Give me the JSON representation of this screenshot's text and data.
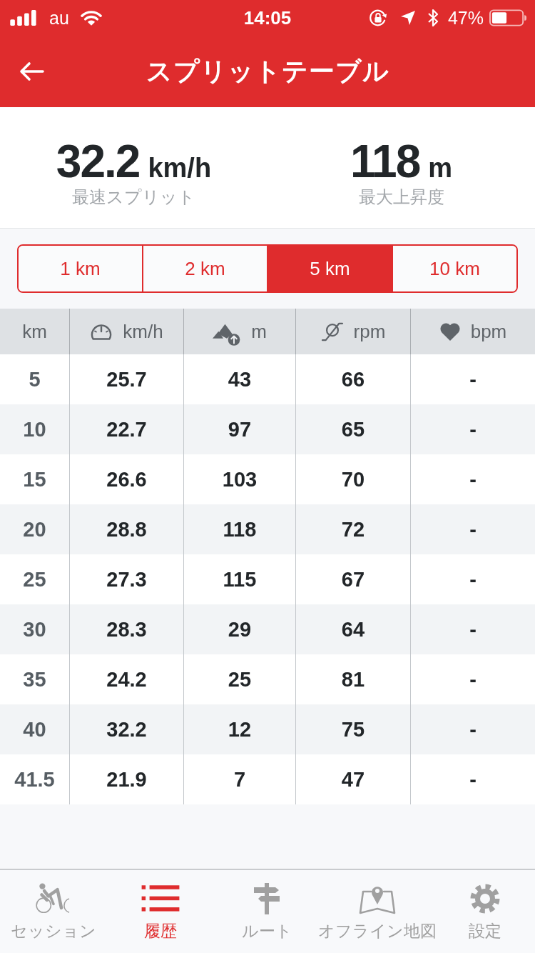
{
  "status_bar": {
    "carrier": "au",
    "time": "14:05",
    "battery": "47%"
  },
  "nav": {
    "title": "スプリットテーブル"
  },
  "summary": [
    {
      "value": "32.2",
      "unit": "km/h",
      "label": "最速スプリット"
    },
    {
      "value": "118",
      "unit": "m",
      "label": "最大上昇度"
    }
  ],
  "segments": [
    {
      "label": "1 km",
      "selected": false
    },
    {
      "label": "2 km",
      "selected": false
    },
    {
      "label": "5 km",
      "selected": true
    },
    {
      "label": "10 km",
      "selected": false
    }
  ],
  "table": {
    "columns": [
      "km",
      "km/h",
      "m",
      "rpm",
      "bpm"
    ],
    "rows": [
      [
        "5",
        "25.7",
        "43",
        "66",
        "-"
      ],
      [
        "10",
        "22.7",
        "97",
        "65",
        "-"
      ],
      [
        "15",
        "26.6",
        "103",
        "70",
        "-"
      ],
      [
        "20",
        "28.8",
        "118",
        "72",
        "-"
      ],
      [
        "25",
        "27.3",
        "115",
        "67",
        "-"
      ],
      [
        "30",
        "28.3",
        "29",
        "64",
        "-"
      ],
      [
        "35",
        "24.2",
        "25",
        "81",
        "-"
      ],
      [
        "40",
        "32.2",
        "12",
        "75",
        "-"
      ],
      [
        "41.5",
        "21.9",
        "7",
        "47",
        "-"
      ]
    ]
  },
  "tab_bar": [
    {
      "label": "セッション",
      "selected": false
    },
    {
      "label": "履歴",
      "selected": true
    },
    {
      "label": "ルート",
      "selected": false
    },
    {
      "label": "オフライン地図",
      "selected": false
    },
    {
      "label": "設定",
      "selected": false
    }
  ]
}
